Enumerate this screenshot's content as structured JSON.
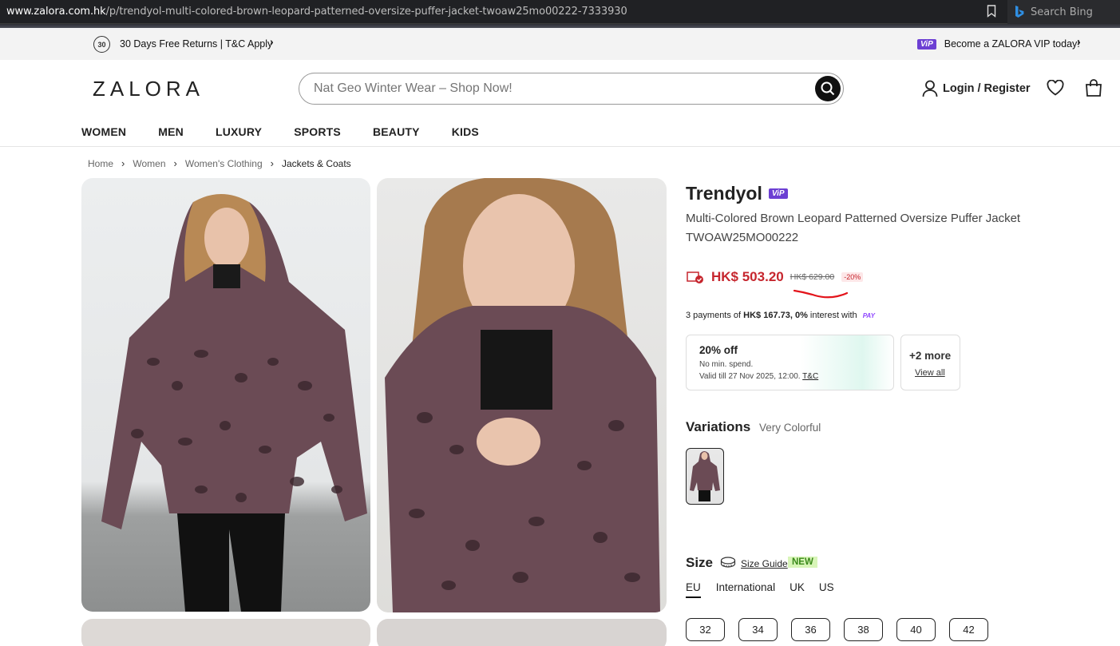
{
  "browser": {
    "url_host": "www.zalora.com.hk",
    "url_path": "/p/trendyol-multi-colored-brown-leopard-patterned-oversize-puffer-jacket-twoaw25mo00222-7333930",
    "search_label": "Search Bing"
  },
  "promo": {
    "returns_icon_text": "30",
    "returns_text": "30 Days Free Returns | T&C Apply",
    "vip_badge": "ViP",
    "vip_text": "Become a ZALORA VIP today!"
  },
  "header": {
    "logo": "ZALORA",
    "search_placeholder": "Nat Geo Winter Wear – Shop Now!",
    "login": "Login / Register"
  },
  "nav": [
    "WOMEN",
    "MEN",
    "LUXURY",
    "SPORTS",
    "BEAUTY",
    "KIDS"
  ],
  "breadcrumb": [
    "Home",
    "Women",
    "Women's Clothing",
    "Jackets & Coats"
  ],
  "product": {
    "brand": "Trendyol",
    "vip_badge": "ViP",
    "title": "Multi-Colored Brown Leopard Patterned Oversize Puffer Jacket",
    "sku": "TWOAW25MO00222",
    "price_now": "HK$ 503.20",
    "price_old": "HK$ 629.00",
    "discount": "-20%",
    "payments_prefix": "3 payments of ",
    "payments_amount": "HK$ 167.73, 0%",
    "payments_suffix": " interest with ",
    "pay_logo": "PAY"
  },
  "voucher": {
    "title": "20% off",
    "subtitle": "No min. spend.",
    "valid": "Valid till 27 Nov 2025, 12:00. ",
    "tc": "T&C",
    "more_title": "+2 more",
    "more_link": "View all"
  },
  "variations": {
    "title": "Variations",
    "value": "Very Colorful"
  },
  "size": {
    "title": "Size",
    "guide": "Size Guide",
    "new_badge": "NEW",
    "tabs": [
      "EU",
      "International",
      "UK",
      "US"
    ],
    "active_tab": "EU",
    "options": [
      "32",
      "34",
      "36",
      "38",
      "40",
      "42"
    ]
  },
  "colors": {
    "price_red": "#c6262e",
    "vip_purple": "#6c3fd3",
    "new_green": "#d8f5b8"
  }
}
